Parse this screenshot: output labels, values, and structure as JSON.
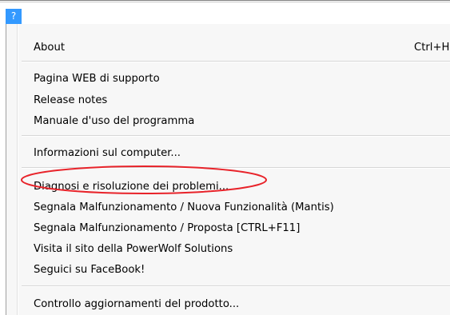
{
  "menubar": {
    "help_menu_label": "?"
  },
  "menu": {
    "items": [
      {
        "label": "About",
        "shortcut": "Ctrl+H"
      },
      {
        "label": "Pagina WEB di supporto"
      },
      {
        "label": "Release notes"
      },
      {
        "label": "Manuale d'uso del programma"
      },
      {
        "label": "Informazioni sul computer..."
      },
      {
        "label": "Diagnosi e risoluzione dei problemi..."
      },
      {
        "label": "Segnala Malfunzionamento / Nuova Funzionalità (Mantis)"
      },
      {
        "label": "Segnala Malfunzionamento / Proposta [CTRL+F11]"
      },
      {
        "label": "Visita il sito della PowerWolf Solutions"
      },
      {
        "label": "Seguici su FaceBook!"
      },
      {
        "label": "Controllo aggiornamenti del prodotto..."
      }
    ]
  },
  "colors": {
    "menu_highlight": "#3399ff",
    "annotation_ellipse": "#e8232a",
    "menu_background": "#f7f7f7"
  }
}
